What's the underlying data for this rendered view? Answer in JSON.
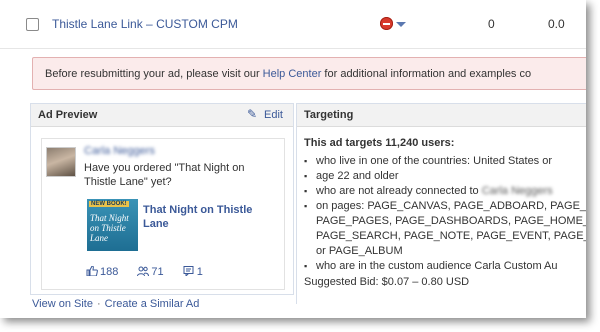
{
  "ad_row": {
    "name": "Thistle Lane Link – CUSTOM CPM",
    "status_icon": "no-entry-icon",
    "value_1": "0",
    "value_2": "0.0"
  },
  "alert": {
    "text_before": "Before resubmitting your ad, please visit our ",
    "link": "Help Center",
    "text_after": " for additional information and examples co"
  },
  "preview": {
    "title": "Ad Preview",
    "edit_label": "Edit",
    "advertiser_name": "Carla Neggers",
    "body": "Have you ordered \"That Night on Thistle Lane\" yet?",
    "book_badge": "NEW BOOK!",
    "book_title": "That Night on Thistle Lane",
    "page_link": "That Night on Thistle Lane",
    "likes": "188",
    "people": "71",
    "posts": "1"
  },
  "links": {
    "view_on_site": "View on Site",
    "separator": "·",
    "create_similar": "Create a Similar Ad"
  },
  "targeting": {
    "title": "Targeting",
    "summary": "This ad targets 11,240 users:",
    "items": [
      "who live in one of the countries: United States or",
      "age 22 and older",
      "who are not already connected to",
      "on pages: PAGE_CANVAS, PAGE_ADBOARD, PAGE_",
      "PAGE_PAGES, PAGE_DASHBOARDS, PAGE_HOME_F",
      "PAGE_SEARCH, PAGE_NOTE, PAGE_EVENT, PAGE_C",
      "or PAGE_ALBUM",
      "who are in the custom audience Carla Custom Au"
    ],
    "blurred_name": "Carla Neggers",
    "suggested_bid": "Suggested Bid: $0.07 – 0.80 USD"
  },
  "colors": {
    "link": "#3b5998",
    "alert_bg": "#fbebeb",
    "alert_border": "#e3b1b1",
    "status_red": "#d8392b"
  }
}
